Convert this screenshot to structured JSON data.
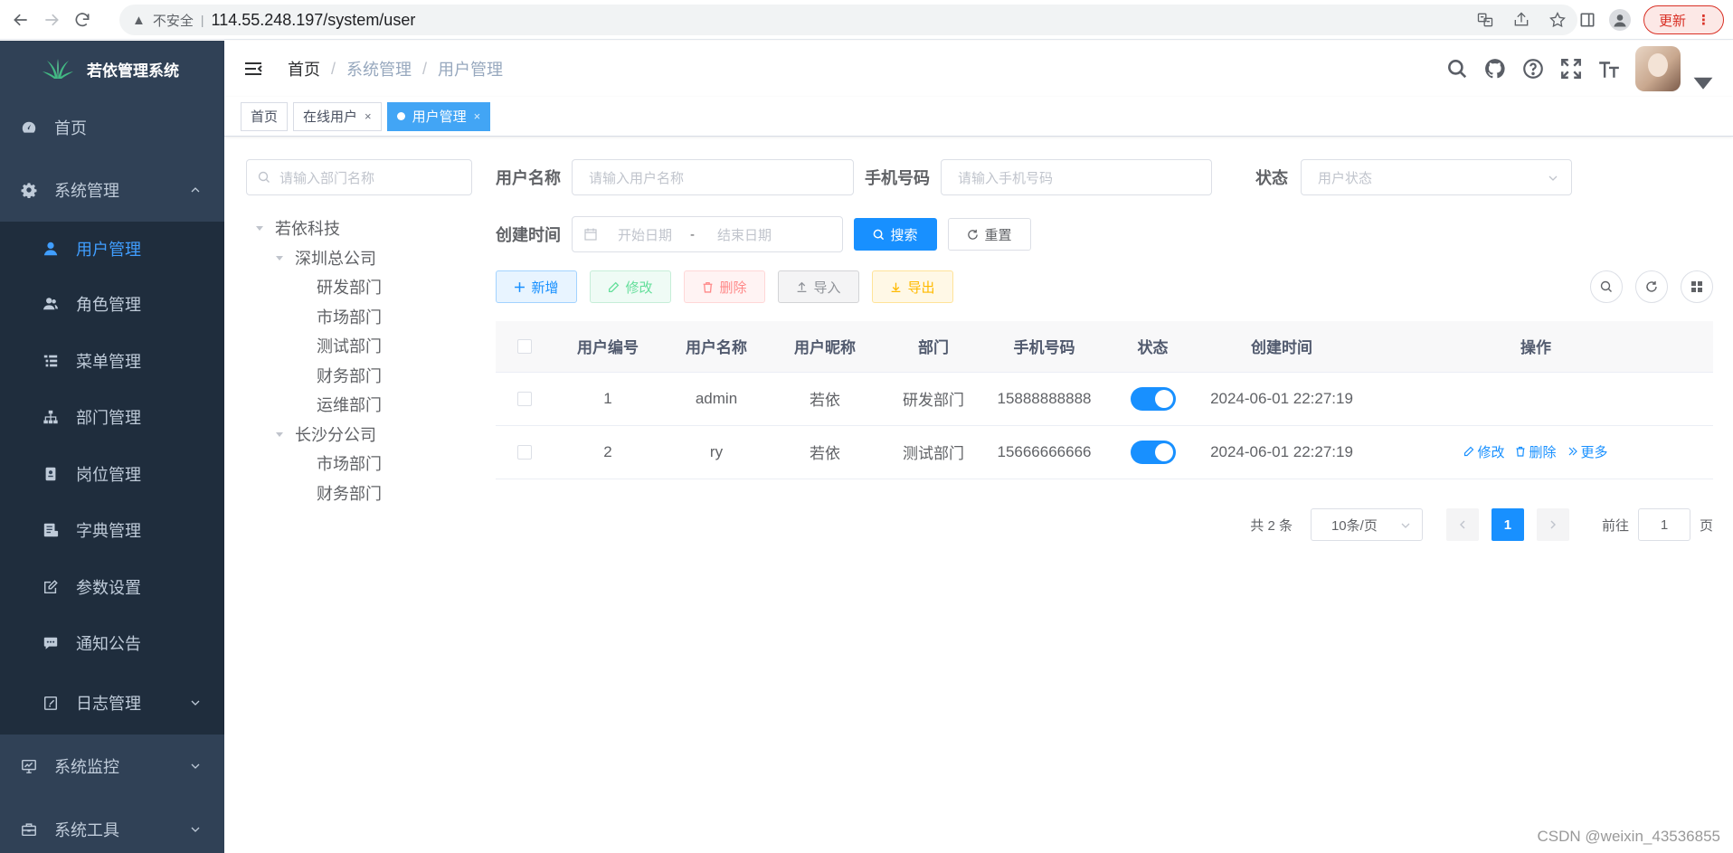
{
  "browser": {
    "security": "不安全",
    "url": "114.55.248.197/system/user",
    "update_label": "更新"
  },
  "app": {
    "title": "若依管理系统"
  },
  "sidebar": {
    "home": "首页",
    "system": "系统管理",
    "sub_items": [
      {
        "label": "用户管理",
        "icon": "user-icon"
      },
      {
        "label": "角色管理",
        "icon": "peoples-icon"
      },
      {
        "label": "菜单管理",
        "icon": "tree-table-icon"
      },
      {
        "label": "部门管理",
        "icon": "tree-icon"
      },
      {
        "label": "岗位管理",
        "icon": "post-icon"
      },
      {
        "label": "字典管理",
        "icon": "dict-icon"
      },
      {
        "label": "参数设置",
        "icon": "edit-icon"
      },
      {
        "label": "通知公告",
        "icon": "message-icon"
      },
      {
        "label": "日志管理",
        "icon": "log-icon"
      }
    ],
    "monitor": "系统监控",
    "tools": "系统工具"
  },
  "breadcrumb": [
    "首页",
    "系统管理",
    "用户管理"
  ],
  "tags": [
    {
      "label": "首页"
    },
    {
      "label": "在线用户"
    },
    {
      "label": "用户管理"
    }
  ],
  "tree": {
    "search_placeholder": "请输入部门名称",
    "root": "若依科技",
    "branch1": "深圳总公司",
    "branch1_children": [
      "研发部门",
      "市场部门",
      "测试部门",
      "财务部门",
      "运维部门"
    ],
    "branch2": "长沙分公司",
    "branch2_children": [
      "市场部门",
      "财务部门"
    ]
  },
  "search_form": {
    "username_label": "用户名称",
    "username_placeholder": "请输入用户名称",
    "phone_label": "手机号码",
    "phone_placeholder": "请输入手机号码",
    "status_label": "状态",
    "status_placeholder": "用户状态",
    "created_label": "创建时间",
    "start_placeholder": "开始日期",
    "range_sep": "-",
    "end_placeholder": "结束日期",
    "search_btn": "搜索",
    "reset_btn": "重置"
  },
  "toolbar": {
    "add": "新增",
    "edit": "修改",
    "delete": "删除",
    "import": "导入",
    "export": "导出"
  },
  "table": {
    "headers": [
      "用户编号",
      "用户名称",
      "用户昵称",
      "部门",
      "手机号码",
      "状态",
      "创建时间",
      "操作"
    ],
    "rows": [
      {
        "id": "1",
        "username": "admin",
        "nickname": "若依",
        "dept": "研发部门",
        "phone": "15888888888",
        "status_on": true,
        "created": "2024-06-01 22:27:19"
      },
      {
        "id": "2",
        "username": "ry",
        "nickname": "若依",
        "dept": "测试部门",
        "phone": "15666666666",
        "status_on": true,
        "created": "2024-06-01 22:27:19"
      }
    ],
    "op_edit": "修改",
    "op_delete": "删除",
    "op_more": "更多"
  },
  "pagination": {
    "total": "共 2 条",
    "page_size": "10条/页",
    "current": "1",
    "goto_label": "前往",
    "goto_value": "1",
    "goto_suffix": "页"
  },
  "watermark": "CSDN @weixin_43536855",
  "colors": {
    "sidebar_bg": "#304156",
    "submenu_bg": "#1f2d3d",
    "primary": "#1890ff",
    "active_menu": "#409eff"
  }
}
